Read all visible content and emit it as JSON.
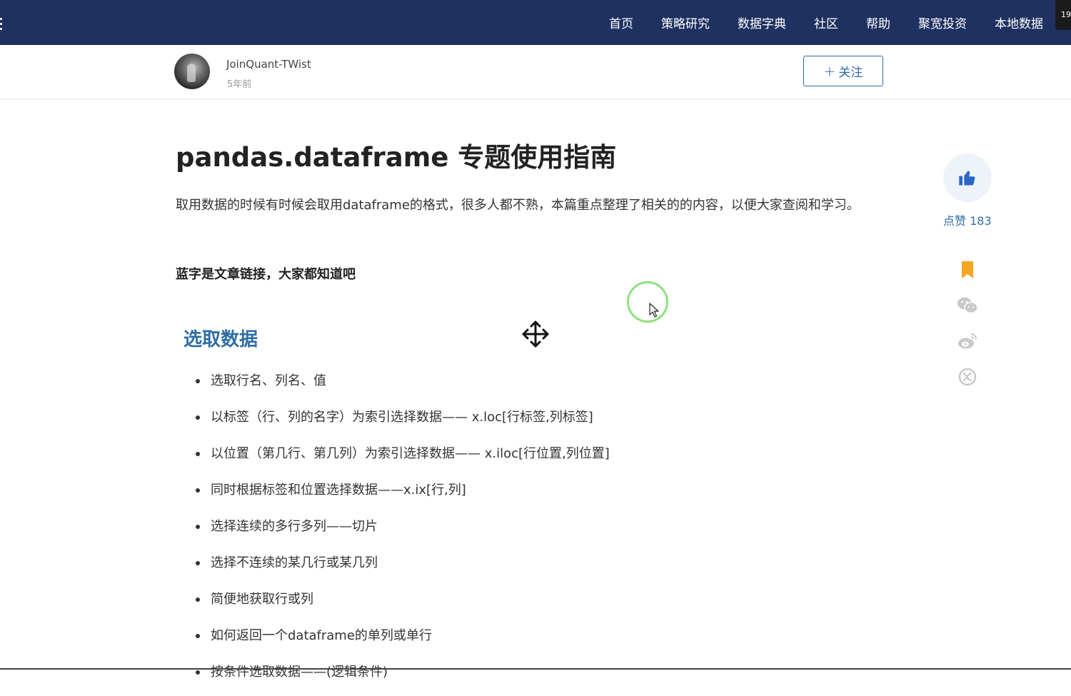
{
  "nav": {
    "links": [
      "首页",
      "策略研究",
      "数据字典",
      "社区",
      "帮助",
      "聚宽投资",
      "本地数据"
    ],
    "corner_badge": "19"
  },
  "author": {
    "name": "JoinQuant-TWist",
    "time": "5年前",
    "follow_label": "关注"
  },
  "article": {
    "title": "pandas.dataframe 专题使用指南",
    "intro": "取用数据的时候有时候会取用dataframe的格式，很多人都不熟，本篇重点整理了相关的的内容，以便大家查阅和学习。",
    "bold_note": "蓝字是文章链接，大家都知道吧",
    "section_heading": "选取数据",
    "bullets": [
      "选取行名、列名、值",
      "以标签（行、列的名字）为索引选择数据—— x.loc[行标签,列标签]",
      "以位置（第几行、第几列）为索引选择数据—— x.iloc[行位置,列位置]",
      "同时根据标签和位置选择数据——x.ix[行,列]",
      "选择连续的多行多列——切片",
      "选择不连续的某几行或某几列",
      "简便地获取行或列",
      "如何返回一个dataframe的单列或单行",
      "按条件选取数据——(逻辑条件)"
    ]
  },
  "sidebar": {
    "like_label": "点赞 183",
    "icons": [
      "thumbs-up-icon",
      "bookmark-icon",
      "wechat-icon",
      "weibo-icon",
      "share-icon"
    ],
    "colors": {
      "accent": "#2f6ea5",
      "bookmark": "#f5a623",
      "nav_bg": "#1f3160"
    }
  }
}
